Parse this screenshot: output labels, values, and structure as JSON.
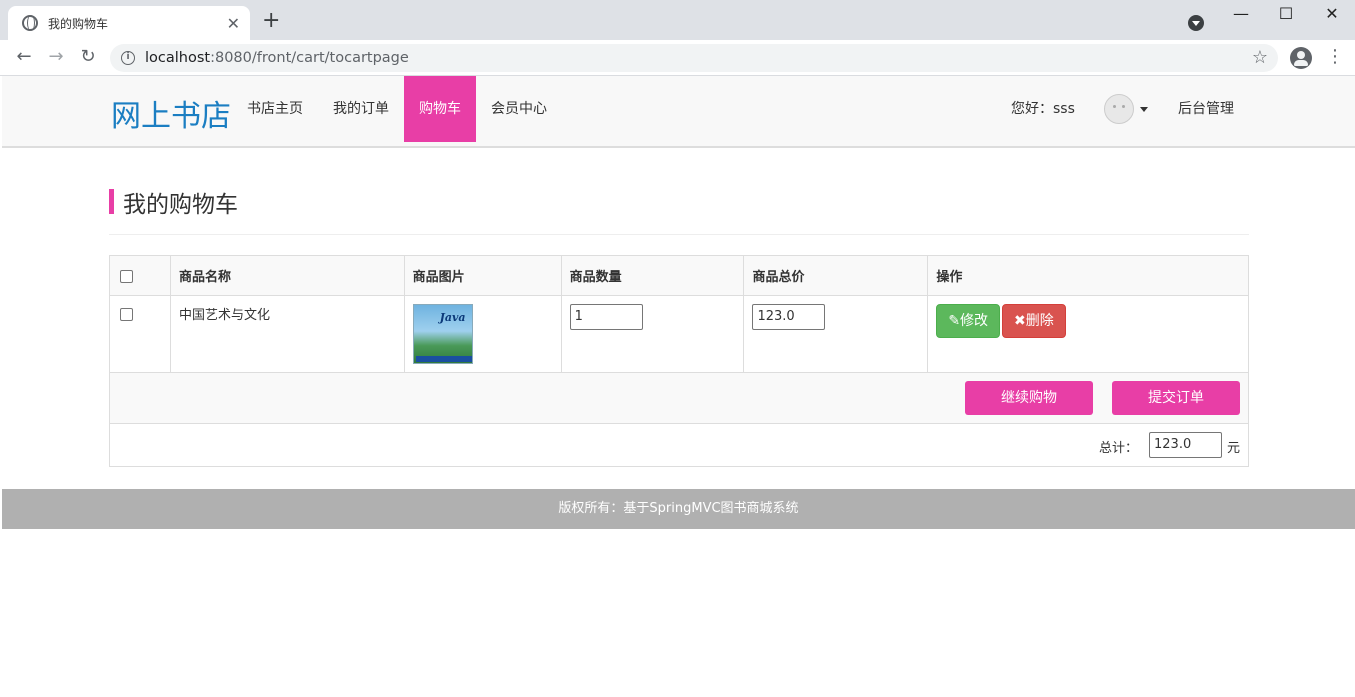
{
  "browser": {
    "tab_title": "我的购物车",
    "url_host": "localhost",
    "url_path": ":8080/front/cart/tocartpage"
  },
  "nav": {
    "brand": "网上书店",
    "items": [
      {
        "label": "书店主页"
      },
      {
        "label": "我的订单"
      },
      {
        "label": "购物车",
        "active": true
      },
      {
        "label": "会员中心"
      }
    ],
    "greeting": "您好：sss",
    "admin": "后台管理"
  },
  "page": {
    "title": "我的购物车"
  },
  "cart": {
    "headers": [
      "商品名称",
      "商品图片",
      "商品数量",
      "商品总价",
      "操作"
    ],
    "rows": [
      {
        "name": "中国艺术与文化",
        "image_text": "Java",
        "quantity": "1",
        "total": "123.0",
        "edit_label": "修改",
        "delete_label": "删除"
      }
    ],
    "continue_label": "继续购物",
    "submit_label": "提交订单",
    "total_label": "总计：",
    "total_value": "123.0",
    "total_unit": "元"
  },
  "footer": {
    "text": "版权所有：基于SpringMVC图书商城系统"
  },
  "colors": {
    "accent": "#e83ea6",
    "brand": "#1b7ec2",
    "success": "#5cb85c",
    "danger": "#d9534f"
  }
}
